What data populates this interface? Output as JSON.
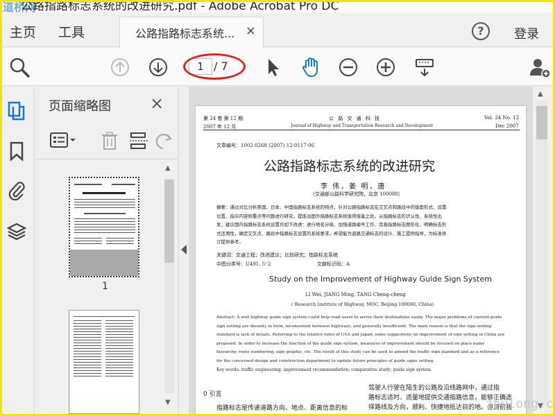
{
  "window": {
    "title": "公路指路标志系统的改进研究.pdf - Adobe Acrobat Pro DC",
    "watermark": "道桥网"
  },
  "menu": {
    "home": "主页",
    "tools": "工具",
    "doc_tab": "公路指路标志系统...",
    "doc_tab_close": "×",
    "help": "?",
    "login": "登录"
  },
  "toolbar": {
    "page_current": "1",
    "page_total": "/ 7"
  },
  "thumbnails": {
    "title": "页面缩略图",
    "close": "×",
    "page1_label": "1"
  },
  "document": {
    "header_left_1": "第 24 卷  第 12 期",
    "header_left_2": "2007 年 12 月",
    "header_center_1": "公 路 交 通 科 技",
    "header_center_2": "Journal of Highway and Transportation Research and Development",
    "header_right_1": "Vol. 24   No. 12",
    "header_right_2": "Dec  2007",
    "article_no": "文章编号：1002-0268 (2007) 12-0117-06",
    "title_cn": "公路指路标志系统的改进研究",
    "authors_cn": "李  伟，姜  明，唐",
    "affiliation_cn": "（交通部公路科学研究院，北京  100088）",
    "abstract_cn": [
      "摘要：通过对比分析美国、日本、中国指路标志系统的特点，针对公路指路标志在交叉点和路段中的版面形式、设置",
      "位置、指示内容侧重点等问题进行研究，提炼出国外指路标志系统值得借鉴之处。从指路标志的识认性、系统性出",
      "发，建议国内指路标志系统设置作如下改进：进行地名分级、加强道路编号工作、完善指路标志图形化、明确标志形",
      "式适用性，确定交叉点、路段中指路标志设置的系统要求。希望能为道路交通标志的设计、施工提供指导，为标准修",
      "订提供参考。"
    ],
    "keywords_cn": "关键词：交通工程；改进建议；比较研究；指路标志系统",
    "class_no": "中图分类号：U491. 5⁺2",
    "doc_code": "文献标识码：A",
    "title_en": "Study on the Improvement of Highway Guide Sign System",
    "authors_en": "LI Wei,  JIANG Ming,  TANG Cheng-cheng",
    "affiliation_en": "( Research Institute of Highway,  MOC,  Beijing  100088,  China)",
    "abstract_en": [
      "Abstract: A well highway guide sign system could help road users to arrive their destinations easily. The major problems of current guide",
      "sign setting are disunity in form,  inconsistent between highways,  and generally insufficient. The main reason is that the sign-setting",
      "standard is lack of details. Referring to the relative rules of USA and Japan,  some suggestions on improvement of sign setting in China are",
      "proposed. In order to increase the function of the guide sign system,  measures of improvement should be focused on place name",
      "hierarchy, route numbering,  sign graphic,  etc. The result of this study can be used to amend the traffic sign standard and as a reference",
      "for the concerned design and construction department to update future principles of guide signs setting."
    ],
    "keywords_en": "Key words:  traffic engineering;  improvement recommendation;  comparative study;  guide sign system",
    "intro_heading": "0  引言",
    "intro_left": "指路标志是传递道路方向、地点、距离信息的标",
    "intro_right_1": "驾驶人行驶在陌生的公路及沿线路网中，通过指",
    "intro_right_2": "路标志适时、适量地提供交通指路信息，能够正确选",
    "intro_right_3": "择路线及方向，顺利、快捷地抵达目的地。但目前我"
  },
  "corner_watermark": "zhulong.com"
}
